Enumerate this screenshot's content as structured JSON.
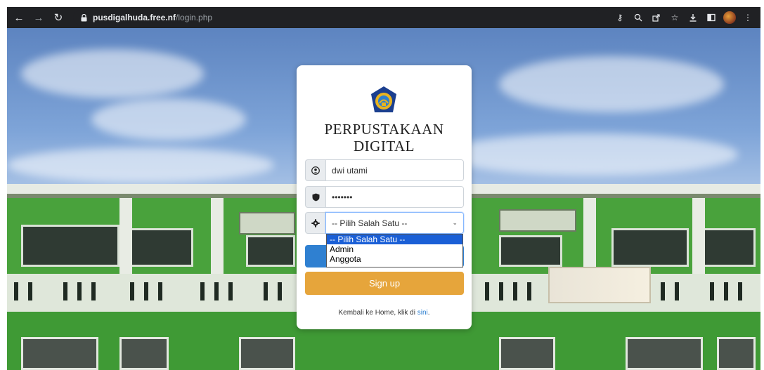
{
  "browser": {
    "url_host": "pusdigalhuda.free.nf",
    "url_path": "/login.php",
    "icons": [
      "back-arrow-icon",
      "forward-arrow-icon",
      "reload-icon",
      "lock-icon",
      "key-icon",
      "zoom-icon",
      "share-icon",
      "star-icon",
      "download-icon",
      "sidebar-icon",
      "profile-avatar",
      "menu-dots-icon"
    ]
  },
  "login": {
    "title_line1": "PERPUSTAKAAN",
    "title_line2": "DIGITAL",
    "username_value": "dwi utami",
    "password_value": "•••••••",
    "role_select": {
      "value": "-- Pilih Salah Satu --",
      "options": [
        "-- Pilih Salah Satu --",
        "Admin",
        "Anggota"
      ]
    },
    "signup_label": "Sign up",
    "back_text": "Kembali ke Home, klik di ",
    "back_link": "sini",
    "back_suffix": "."
  },
  "colors": {
    "primary_blue": "#2f80d1",
    "signup_orange": "#e6a53b",
    "building_green": "#49a23c"
  }
}
